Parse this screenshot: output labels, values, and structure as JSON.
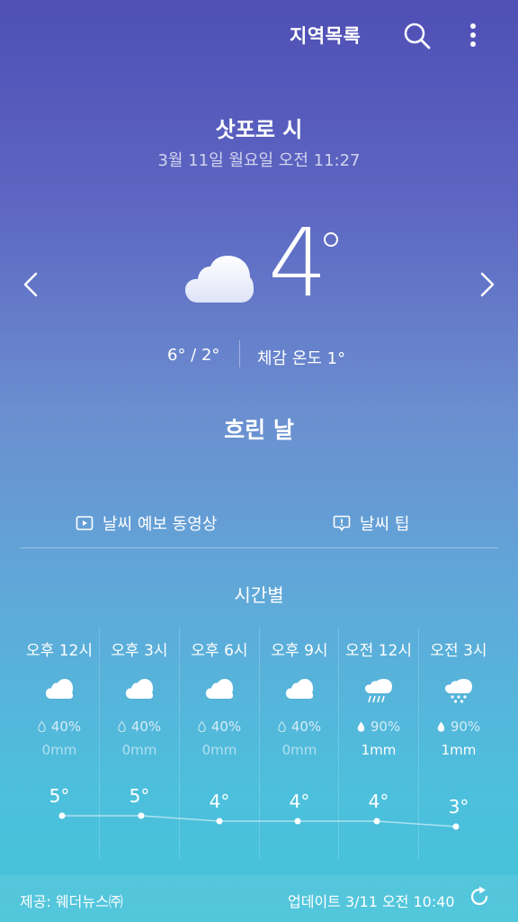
{
  "header": {
    "region_list_label": "지역목록",
    "search_icon": "search-icon",
    "more_icon": "more-vert-icon"
  },
  "location": {
    "city": "삿포로 시",
    "datetime": "3월 11일 월요일 오전 11:27"
  },
  "current": {
    "icon": "cloud-icon",
    "temperature": "4",
    "high_low": "6° / 2°",
    "feels_like": "체감 온도 1°",
    "condition": "흐린 날"
  },
  "links": {
    "video": "날씨 예보 동영상",
    "tips": "날씨 팁"
  },
  "hourly": {
    "title": "시간별",
    "items": [
      {
        "time": "오후 12시",
        "icon": "cloud-icon",
        "pop": "40%",
        "precip": "0mm",
        "temp": "5°",
        "temp_value": 5
      },
      {
        "time": "오후 3시",
        "icon": "cloud-icon",
        "pop": "40%",
        "precip": "0mm",
        "temp": "5°",
        "temp_value": 5
      },
      {
        "time": "오후 6시",
        "icon": "cloud-icon",
        "pop": "40%",
        "precip": "0mm",
        "temp": "4°",
        "temp_value": 4
      },
      {
        "time": "오후 9시",
        "icon": "cloud-icon",
        "pop": "40%",
        "precip": "0mm",
        "temp": "4°",
        "temp_value": 4
      },
      {
        "time": "오전 12시",
        "icon": "cloud-rain-icon",
        "pop": "90%",
        "precip": "1mm",
        "temp": "4°",
        "temp_value": 4
      },
      {
        "time": "오전 3시",
        "icon": "cloud-snow-icon",
        "pop": "90%",
        "precip": "1mm",
        "temp": "3°",
        "temp_value": 3
      }
    ]
  },
  "footer": {
    "provider": "제공: 웨더뉴스㈜",
    "updated": "업데이트 3/11 오전 10:40",
    "refresh_icon": "refresh-icon"
  }
}
